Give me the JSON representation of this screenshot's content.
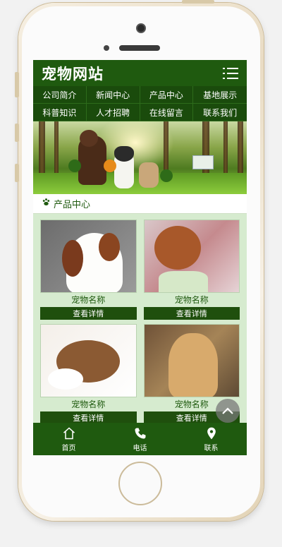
{
  "header": {
    "logo": "宠物网站",
    "menu_icon": "menu-icon"
  },
  "nav": [
    {
      "label": "公司简介"
    },
    {
      "label": "新闻中心"
    },
    {
      "label": "产品中心"
    },
    {
      "label": "基地展示"
    },
    {
      "label": "科普知识"
    },
    {
      "label": "人才招聘"
    },
    {
      "label": "在线留言"
    },
    {
      "label": "联系我们"
    }
  ],
  "section": {
    "title": "产品中心",
    "icon": "paw-icon"
  },
  "products": [
    {
      "name": "宠物名称",
      "button": "查看详情"
    },
    {
      "name": "宠物名称",
      "button": "查看详情"
    },
    {
      "name": "宠物名称",
      "button": "查看详情"
    },
    {
      "name": "宠物名称",
      "button": "查看详情"
    }
  ],
  "footer": [
    {
      "label": "首页",
      "icon": "home-icon"
    },
    {
      "label": "电话",
      "icon": "phone-icon"
    },
    {
      "label": "联系",
      "icon": "location-icon"
    }
  ],
  "colors": {
    "primary": "#1f5a0f",
    "panel": "#d6ebcf"
  }
}
